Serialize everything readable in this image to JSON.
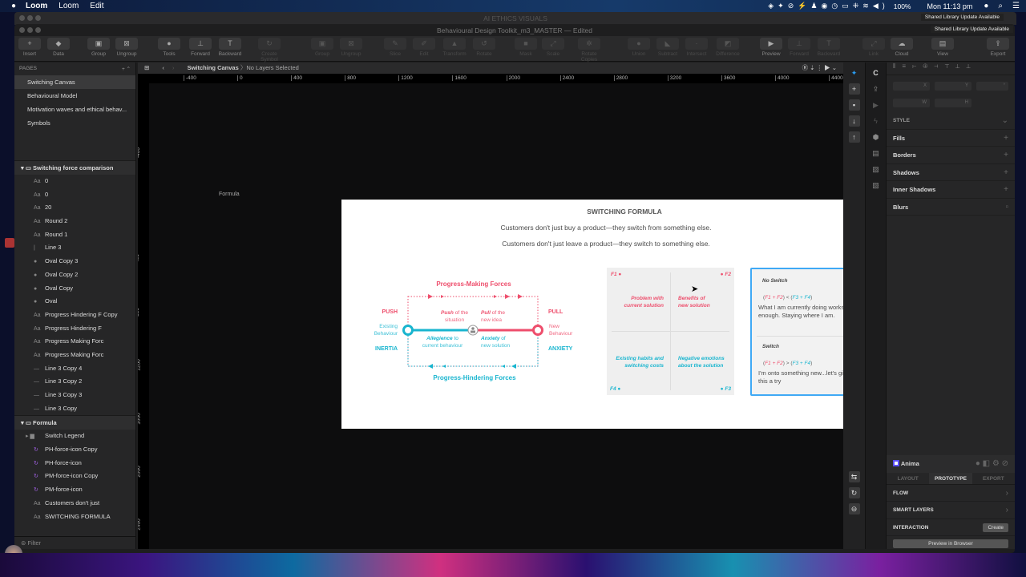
{
  "menubar": {
    "apple": "",
    "items": [
      "Loom",
      "Loom",
      "Edit"
    ],
    "status_icons": [
      "sketch-icon",
      "pin-icon",
      "vpn-icon",
      "bolt-icon",
      "user-icon",
      "pause-icon",
      "clock-icon",
      "airplay-icon",
      "bluetooth-icon",
      "wifi-icon",
      "volume-icon"
    ],
    "battery": "100%",
    "clock": "Mon 11:13 pm"
  },
  "back_window": {
    "title": "AI ETHICS VISUALS",
    "notice": "Shared Library Update Available"
  },
  "window": {
    "title": "Behavioural Design Toolkit_m3_MASTER — Edited",
    "notice": "Shared Library Update Available"
  },
  "toolbar": [
    {
      "label": "Insert",
      "icon": "+",
      "dim": false
    },
    {
      "label": "Data",
      "icon": "◆",
      "dim": false
    },
    {
      "label": "Group",
      "icon": "▣",
      "dim": false
    },
    {
      "label": "Ungroup",
      "icon": "⊠",
      "dim": false
    },
    {
      "label": "Tools",
      "icon": "●",
      "dim": false
    },
    {
      "label": "Forward",
      "icon": "⊥",
      "dim": false
    },
    {
      "label": "Backward",
      "icon": "T",
      "dim": false
    },
    {
      "label": "Create Symbol",
      "icon": "↻",
      "dim": true
    },
    {
      "label": "Group",
      "icon": "▣",
      "dim": true
    },
    {
      "label": "Ungroup",
      "icon": "⊠",
      "dim": true
    },
    {
      "label": "Slice",
      "icon": "✎",
      "dim": true
    },
    {
      "label": "Edit",
      "icon": "✐",
      "dim": true
    },
    {
      "label": "Transform",
      "icon": "▲",
      "dim": true
    },
    {
      "label": "Rotate",
      "icon": "↺",
      "dim": true
    },
    {
      "label": "Mask",
      "icon": "■",
      "dim": true
    },
    {
      "label": "Scale",
      "icon": "⤢",
      "dim": true
    },
    {
      "label": "Rotate Copies",
      "icon": "✲",
      "dim": true
    },
    {
      "label": "Union",
      "icon": "●",
      "dim": true
    },
    {
      "label": "Subtract",
      "icon": "◣",
      "dim": true
    },
    {
      "label": "Intersect",
      "icon": "·",
      "dim": true
    },
    {
      "label": "Difference",
      "icon": "◩",
      "dim": true
    },
    {
      "label": "Preview",
      "icon": "▶",
      "dim": false
    },
    {
      "label": "Forward",
      "icon": "⊥",
      "dim": true
    },
    {
      "label": "Backward",
      "icon": "T",
      "dim": true
    },
    {
      "label": "Link",
      "icon": "⤢",
      "dim": true
    },
    {
      "label": "Cloud",
      "icon": "☁",
      "dim": false
    },
    {
      "label": "View",
      "icon": "▤",
      "dim": false
    },
    {
      "label": "Export",
      "icon": "⇪",
      "dim": false
    }
  ],
  "pages": {
    "header": "PAGES",
    "items": [
      "Switching Canvas",
      "Behavioural Model",
      "Motivation waves and ethical behav...",
      "Symbols"
    ],
    "selected": 0
  },
  "layers": [
    {
      "name": "Switching force comparison",
      "items": [
        {
          "t": "text",
          "n": "0"
        },
        {
          "t": "text",
          "n": "0"
        },
        {
          "t": "text",
          "n": "20"
        },
        {
          "t": "text",
          "n": "Round 2"
        },
        {
          "t": "text",
          "n": "Round 1"
        },
        {
          "t": "vline",
          "n": "Line 3"
        },
        {
          "t": "oval",
          "n": "Oval Copy 3"
        },
        {
          "t": "oval",
          "n": "Oval Copy 2"
        },
        {
          "t": "oval",
          "n": "Oval Copy"
        },
        {
          "t": "oval",
          "n": "Oval"
        },
        {
          "t": "text",
          "n": "Progress Hindering F Copy"
        },
        {
          "t": "text",
          "n": "Progress Hindering F"
        },
        {
          "t": "text",
          "n": "Progress Making Forc"
        },
        {
          "t": "text",
          "n": "Progress Making Forc"
        },
        {
          "t": "line",
          "n": "Line 3 Copy 4"
        },
        {
          "t": "line",
          "n": "Line 3 Copy 2"
        },
        {
          "t": "line",
          "n": "Line 3 Copy 3"
        },
        {
          "t": "line",
          "n": "Line 3 Copy"
        }
      ]
    },
    {
      "name": "Formula",
      "items": [
        {
          "t": "folder",
          "n": "Switch Legend"
        },
        {
          "t": "symbol",
          "n": "PH-force-icon Copy"
        },
        {
          "t": "symbol",
          "n": "PH-force-icon"
        },
        {
          "t": "symbol",
          "n": "PM-force-icon Copy"
        },
        {
          "t": "symbol",
          "n": "PM-force-icon"
        },
        {
          "t": "text",
          "n": "Customers don't just"
        },
        {
          "t": "text",
          "n": "SWITCHING FORMULA"
        }
      ]
    }
  ],
  "filter": {
    "placeholder": "Filter"
  },
  "canvas_bar": {
    "page": "Switching Canvas",
    "selection": "No Layers Selected"
  },
  "rulers": {
    "top": [
      -400,
      0,
      400,
      800,
      1200,
      1600,
      2000,
      2400,
      2800,
      3200,
      3600,
      4000,
      4400
    ],
    "left": [
      -400,
      0,
      400,
      800,
      1200,
      1600,
      2000,
      2400,
      2800
    ]
  },
  "artboard": {
    "label": "Formula",
    "title": "SWITCHING FORMULA",
    "line1": "Customers don't just buy a product—they switch from something else.",
    "line2": "Customers don't just leave a product—they switch to something else.",
    "diagram": {
      "making": "Progress-Making Forces",
      "hindering": "Progress-Hindering Forces",
      "push": "PUSH",
      "pull": "PULL",
      "inertia": "INERTIA",
      "anxiety": "ANXIETY",
      "existing1": "Existing",
      "existing2": "Behaviour",
      "new1": "New",
      "new2": "Behaviour",
      "push_em": "Push",
      "push_rest": " of the",
      "push_l2": "situation",
      "pull_em": "Pull",
      "pull_rest": " of the",
      "pull_l2": "new idea",
      "alleg_em": "Allegience",
      "alleg_rest": " to",
      "alleg_l2": "current behaviour",
      "anx_em": "Anxiety",
      "anx_rest": " of",
      "anx_l2": "new solution"
    },
    "grid": {
      "f1": "F1",
      "f2": "F2",
      "f3": "F3",
      "f4": "F4",
      "q1": [
        "Problem with",
        "current solution"
      ],
      "q2": [
        "Benefits of",
        "new solution"
      ],
      "q4": [
        "Existing habits and",
        "switching costs"
      ],
      "q3": [
        "Negative emotions",
        "about the solution"
      ]
    },
    "formula": {
      "no_switch": "No Switch",
      "ns_a": "F1 + F2",
      "ns_op": " < ",
      "ns_b": "F3 + F4",
      "ns_desc1": "What I am currently doing works well",
      "ns_desc2": "enough. Staying where I am.",
      "switch": "Switch",
      "s_a": "F1 + F2",
      "s_op": " > ",
      "s_b": "F3 + F4",
      "s_desc1": "I'm onto something new...let's give",
      "s_desc2": "this a try"
    },
    "colors": {
      "red": "#ee4e6c",
      "cyan": "#19b5cf",
      "selection": "#3fa9f5"
    }
  },
  "inspector": {
    "fields": [
      "X",
      "Y",
      "°",
      "W",
      "H"
    ],
    "style": "STYLE",
    "rows": [
      "Fills",
      "Borders",
      "Shadows",
      "Inner Shadows",
      "Blurs"
    ]
  },
  "anima": {
    "title": "Anima",
    "tabs": [
      "LAYOUT",
      "PROTOTYPE",
      "EXPORT"
    ],
    "active_tab": 1,
    "flow": "FLOW",
    "smart": "SMART LAYERS",
    "interaction": "INTERACTION",
    "create": "Create",
    "preview": "Preview in Browser"
  }
}
